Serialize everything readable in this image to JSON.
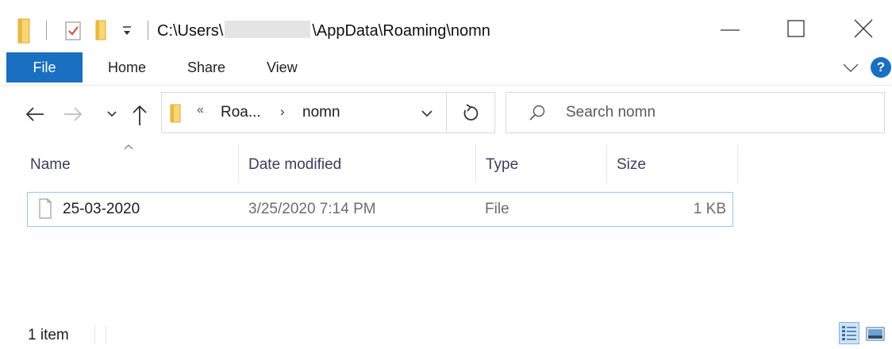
{
  "titlebar": {
    "path_prefix": "C:\\Users\\",
    "path_suffix": "\\AppData\\Roaming\\nomn"
  },
  "ribbon": {
    "tabs": [
      {
        "label": "File"
      },
      {
        "label": "Home"
      },
      {
        "label": "Share"
      },
      {
        "label": "View"
      }
    ],
    "help_label": "?"
  },
  "address_bar": {
    "overflow_marker": "«",
    "crumbs": [
      "Roa...",
      "nomn"
    ],
    "separator": "›"
  },
  "search": {
    "placeholder": "Search nomn"
  },
  "columns": [
    {
      "label": "Name"
    },
    {
      "label": "Date modified"
    },
    {
      "label": "Type"
    },
    {
      "label": "Size"
    }
  ],
  "files": [
    {
      "name": "25-03-2020",
      "date_modified": "3/25/2020 7:14 PM",
      "type": "File",
      "size": "1 KB"
    }
  ],
  "status": {
    "item_count": "1 item"
  },
  "colors": {
    "accent": "#1a6fc1",
    "selection_border": "#99c9ef",
    "folder_yellow": "#f8d775"
  },
  "icons": [
    "folder-icon",
    "properties-icon",
    "new-folder-icon",
    "dropdown-icon",
    "minimize-icon",
    "maximize-icon",
    "close-icon",
    "chevron-down-icon",
    "help-icon",
    "back-arrow-icon",
    "forward-arrow-icon",
    "recent-locations-icon",
    "up-arrow-icon",
    "refresh-icon",
    "search-icon",
    "sort-up-icon",
    "file-icon",
    "details-view-icon",
    "tiles-view-icon"
  ]
}
